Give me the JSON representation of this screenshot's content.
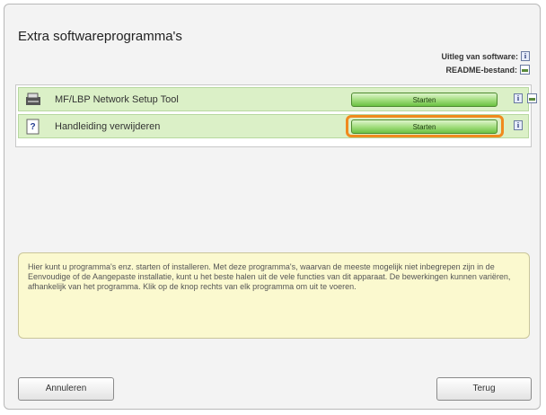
{
  "window": {
    "title": "Extra softwareprogramma's",
    "legend": {
      "software_label": "Uitleg van software:",
      "readme_label": "README-bestand:"
    }
  },
  "programs": [
    {
      "name": "MF/LBP Network Setup Tool",
      "button": "Starten",
      "icon": "network-tool-icon",
      "has_readme": true
    },
    {
      "name": "Handleiding verwijderen",
      "button": "Starten",
      "icon": "uninstall-manual-icon",
      "has_readme": false
    }
  ],
  "description": "Hier kunt u programma's enz. starten of installeren. Met deze programma's, waarvan de meeste mogelijk niet inbegrepen zijn in de Eenvoudige of de Aangepaste installatie, kunt u het beste halen uit de vele functies van dit apparaat. De bewerkingen kunnen variëren, afhankelijk van het programma. Klik op de knop rechts van elk programma om uit te voeren.",
  "footer": {
    "cancel_label": "Annuleren",
    "back_label": "Terug"
  },
  "colors": {
    "row_bg": "#dbf0c7",
    "button_green": "#6cc243",
    "focus_ring": "#f08a1e",
    "description_bg": "#fbf9cf"
  }
}
